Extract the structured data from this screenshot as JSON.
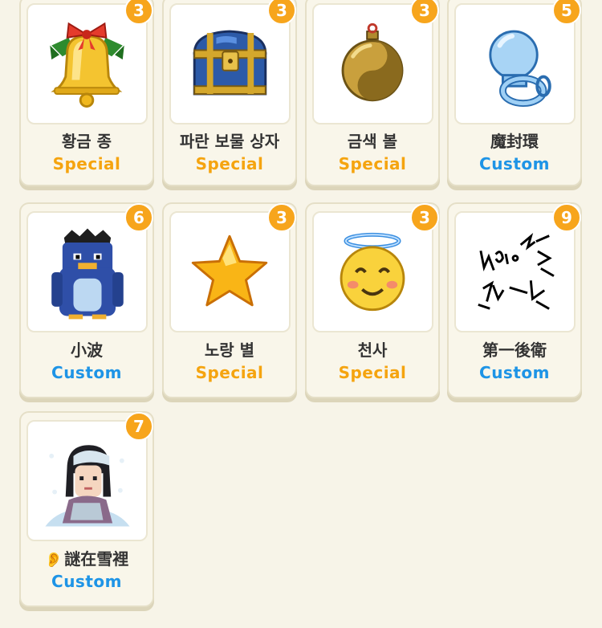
{
  "colors": {
    "special": "#f5a40f",
    "custom": "#1e94e6",
    "badge": "#f7a51c",
    "background": "#f7f4e8"
  },
  "items": [
    {
      "name": "황금 종",
      "type": "Special",
      "count": "3",
      "icon": "golden-bell-icon"
    },
    {
      "name": "파란 보물 상자",
      "type": "Special",
      "count": "3",
      "icon": "blue-treasure-chest-icon"
    },
    {
      "name": "금색 볼",
      "type": "Special",
      "count": "3",
      "icon": "gold-ornament-ball-icon"
    },
    {
      "name": "魔封環",
      "type": "Custom",
      "count": "5",
      "icon": "crystal-ring-icon"
    },
    {
      "name": "小波",
      "type": "Custom",
      "count": "6",
      "icon": "blue-penguin-icon"
    },
    {
      "name": "노랑 별",
      "type": "Special",
      "count": "3",
      "icon": "yellow-star-icon"
    },
    {
      "name": "천사",
      "type": "Special",
      "count": "3",
      "icon": "angel-smiley-icon"
    },
    {
      "name": "第一後衛",
      "type": "Custom",
      "count": "9",
      "icon": "scribble-drawing-icon"
    },
    {
      "name": "謎在雪裡",
      "name_prefix": "👂",
      "type": "Custom",
      "count": "7",
      "icon": "girl-in-snow-icon"
    }
  ]
}
